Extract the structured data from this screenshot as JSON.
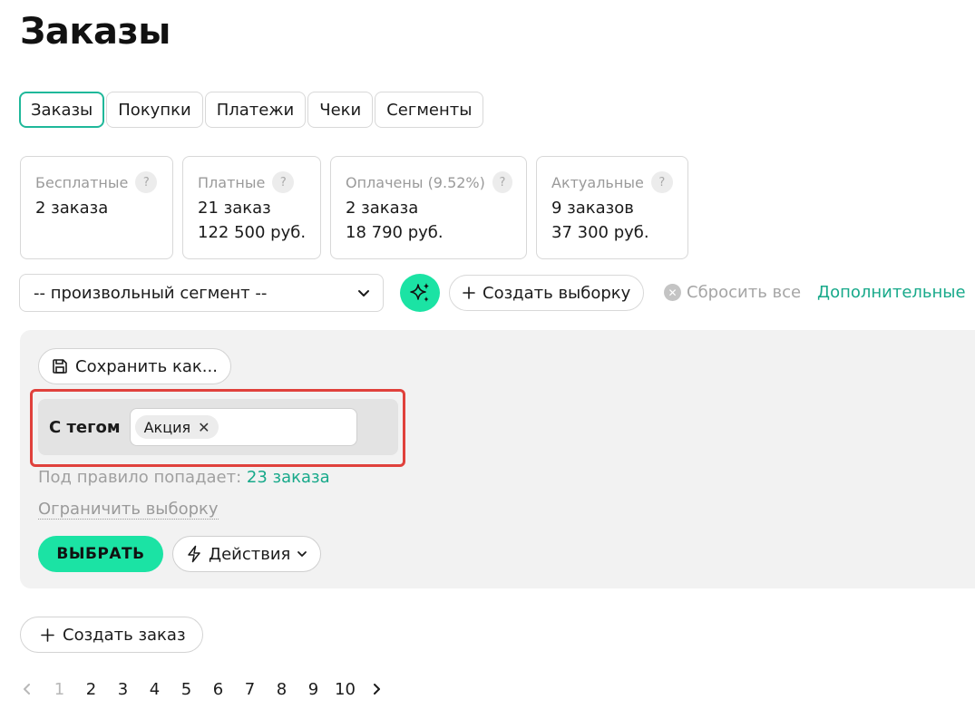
{
  "page": {
    "title": "Заказы"
  },
  "tabs": [
    {
      "label": "Заказы",
      "active": true
    },
    {
      "label": "Покупки"
    },
    {
      "label": "Платежи"
    },
    {
      "label": "Чеки"
    },
    {
      "label": "Сегменты"
    }
  ],
  "stats": [
    {
      "label": "Бесплатные",
      "lines": [
        "2 заказа"
      ]
    },
    {
      "label": "Платные",
      "lines": [
        "21 заказ",
        "122 500 руб."
      ]
    },
    {
      "label": "Оплачены (9.52%)",
      "lines": [
        "2 заказа",
        "18 790 руб."
      ]
    },
    {
      "label": "Актуальные",
      "lines": [
        "9 заказов",
        "37 300 руб."
      ]
    }
  ],
  "stat_help_glyph": "?",
  "filters": {
    "segment_value": "-- произвольный сегмент --",
    "create_selection": "Создать выборку",
    "reset_all": "Сбросить все",
    "more": "Дополнительные"
  },
  "panel": {
    "save_as": "Сохранить как...",
    "rule_label": "С тегом",
    "tag": "Акция",
    "match_prefix": "Под правило попадает:",
    "match_count": "23 заказа",
    "limit": "Ограничить выборку",
    "select": "ВЫБРАТЬ",
    "actions": "Действия"
  },
  "create_order": "Создать заказ",
  "pagination": {
    "pages": [
      "1",
      "2",
      "3",
      "4",
      "5",
      "6",
      "7",
      "8",
      "9",
      "10"
    ],
    "current": "1"
  },
  "colors": {
    "accent": "#1be3a4",
    "link": "#17a98a",
    "highlight_border": "#e0413c",
    "panel_bg": "#f2f2f2"
  }
}
